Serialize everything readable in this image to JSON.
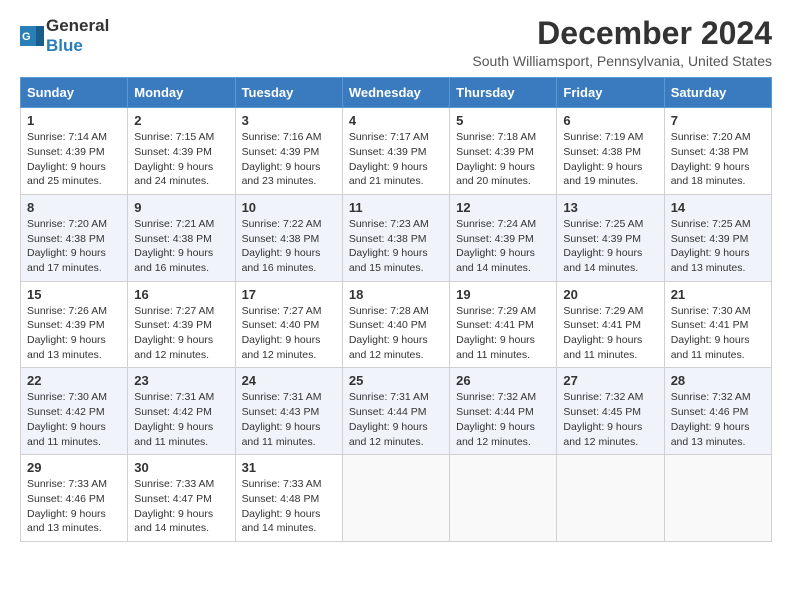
{
  "header": {
    "logo_general": "General",
    "logo_blue": "Blue",
    "title": "December 2024",
    "subtitle": "South Williamsport, Pennsylvania, United States"
  },
  "calendar": {
    "days_of_week": [
      "Sunday",
      "Monday",
      "Tuesday",
      "Wednesday",
      "Thursday",
      "Friday",
      "Saturday"
    ],
    "weeks": [
      [
        null,
        null,
        null,
        null,
        null,
        null,
        null
      ]
    ],
    "cells": [
      {
        "day": 1,
        "col": 0,
        "sunrise": "7:14 AM",
        "sunset": "4:39 PM",
        "daylight": "9 hours and 25 minutes."
      },
      {
        "day": 2,
        "col": 1,
        "sunrise": "7:15 AM",
        "sunset": "4:39 PM",
        "daylight": "9 hours and 24 minutes."
      },
      {
        "day": 3,
        "col": 2,
        "sunrise": "7:16 AM",
        "sunset": "4:39 PM",
        "daylight": "9 hours and 23 minutes."
      },
      {
        "day": 4,
        "col": 3,
        "sunrise": "7:17 AM",
        "sunset": "4:39 PM",
        "daylight": "9 hours and 21 minutes."
      },
      {
        "day": 5,
        "col": 4,
        "sunrise": "7:18 AM",
        "sunset": "4:39 PM",
        "daylight": "9 hours and 20 minutes."
      },
      {
        "day": 6,
        "col": 5,
        "sunrise": "7:19 AM",
        "sunset": "4:38 PM",
        "daylight": "9 hours and 19 minutes."
      },
      {
        "day": 7,
        "col": 6,
        "sunrise": "7:20 AM",
        "sunset": "4:38 PM",
        "daylight": "9 hours and 18 minutes."
      },
      {
        "day": 8,
        "col": 0,
        "sunrise": "7:20 AM",
        "sunset": "4:38 PM",
        "daylight": "9 hours and 17 minutes."
      },
      {
        "day": 9,
        "col": 1,
        "sunrise": "7:21 AM",
        "sunset": "4:38 PM",
        "daylight": "9 hours and 16 minutes."
      },
      {
        "day": 10,
        "col": 2,
        "sunrise": "7:22 AM",
        "sunset": "4:38 PM",
        "daylight": "9 hours and 16 minutes."
      },
      {
        "day": 11,
        "col": 3,
        "sunrise": "7:23 AM",
        "sunset": "4:38 PM",
        "daylight": "9 hours and 15 minutes."
      },
      {
        "day": 12,
        "col": 4,
        "sunrise": "7:24 AM",
        "sunset": "4:39 PM",
        "daylight": "9 hours and 14 minutes."
      },
      {
        "day": 13,
        "col": 5,
        "sunrise": "7:25 AM",
        "sunset": "4:39 PM",
        "daylight": "9 hours and 14 minutes."
      },
      {
        "day": 14,
        "col": 6,
        "sunrise": "7:25 AM",
        "sunset": "4:39 PM",
        "daylight": "9 hours and 13 minutes."
      },
      {
        "day": 15,
        "col": 0,
        "sunrise": "7:26 AM",
        "sunset": "4:39 PM",
        "daylight": "9 hours and 13 minutes."
      },
      {
        "day": 16,
        "col": 1,
        "sunrise": "7:27 AM",
        "sunset": "4:39 PM",
        "daylight": "9 hours and 12 minutes."
      },
      {
        "day": 17,
        "col": 2,
        "sunrise": "7:27 AM",
        "sunset": "4:40 PM",
        "daylight": "9 hours and 12 minutes."
      },
      {
        "day": 18,
        "col": 3,
        "sunrise": "7:28 AM",
        "sunset": "4:40 PM",
        "daylight": "9 hours and 12 minutes."
      },
      {
        "day": 19,
        "col": 4,
        "sunrise": "7:29 AM",
        "sunset": "4:41 PM",
        "daylight": "9 hours and 11 minutes."
      },
      {
        "day": 20,
        "col": 5,
        "sunrise": "7:29 AM",
        "sunset": "4:41 PM",
        "daylight": "9 hours and 11 minutes."
      },
      {
        "day": 21,
        "col": 6,
        "sunrise": "7:30 AM",
        "sunset": "4:41 PM",
        "daylight": "9 hours and 11 minutes."
      },
      {
        "day": 22,
        "col": 0,
        "sunrise": "7:30 AM",
        "sunset": "4:42 PM",
        "daylight": "9 hours and 11 minutes."
      },
      {
        "day": 23,
        "col": 1,
        "sunrise": "7:31 AM",
        "sunset": "4:42 PM",
        "daylight": "9 hours and 11 minutes."
      },
      {
        "day": 24,
        "col": 2,
        "sunrise": "7:31 AM",
        "sunset": "4:43 PM",
        "daylight": "9 hours and 11 minutes."
      },
      {
        "day": 25,
        "col": 3,
        "sunrise": "7:31 AM",
        "sunset": "4:44 PM",
        "daylight": "9 hours and 12 minutes."
      },
      {
        "day": 26,
        "col": 4,
        "sunrise": "7:32 AM",
        "sunset": "4:44 PM",
        "daylight": "9 hours and 12 minutes."
      },
      {
        "day": 27,
        "col": 5,
        "sunrise": "7:32 AM",
        "sunset": "4:45 PM",
        "daylight": "9 hours and 12 minutes."
      },
      {
        "day": 28,
        "col": 6,
        "sunrise": "7:32 AM",
        "sunset": "4:46 PM",
        "daylight": "9 hours and 13 minutes."
      },
      {
        "day": 29,
        "col": 0,
        "sunrise": "7:33 AM",
        "sunset": "4:46 PM",
        "daylight": "9 hours and 13 minutes."
      },
      {
        "day": 30,
        "col": 1,
        "sunrise": "7:33 AM",
        "sunset": "4:47 PM",
        "daylight": "9 hours and 14 minutes."
      },
      {
        "day": 31,
        "col": 2,
        "sunrise": "7:33 AM",
        "sunset": "4:48 PM",
        "daylight": "9 hours and 14 minutes."
      }
    ],
    "labels": {
      "sunrise": "Sunrise:",
      "sunset": "Sunset:",
      "daylight": "Daylight:"
    }
  }
}
